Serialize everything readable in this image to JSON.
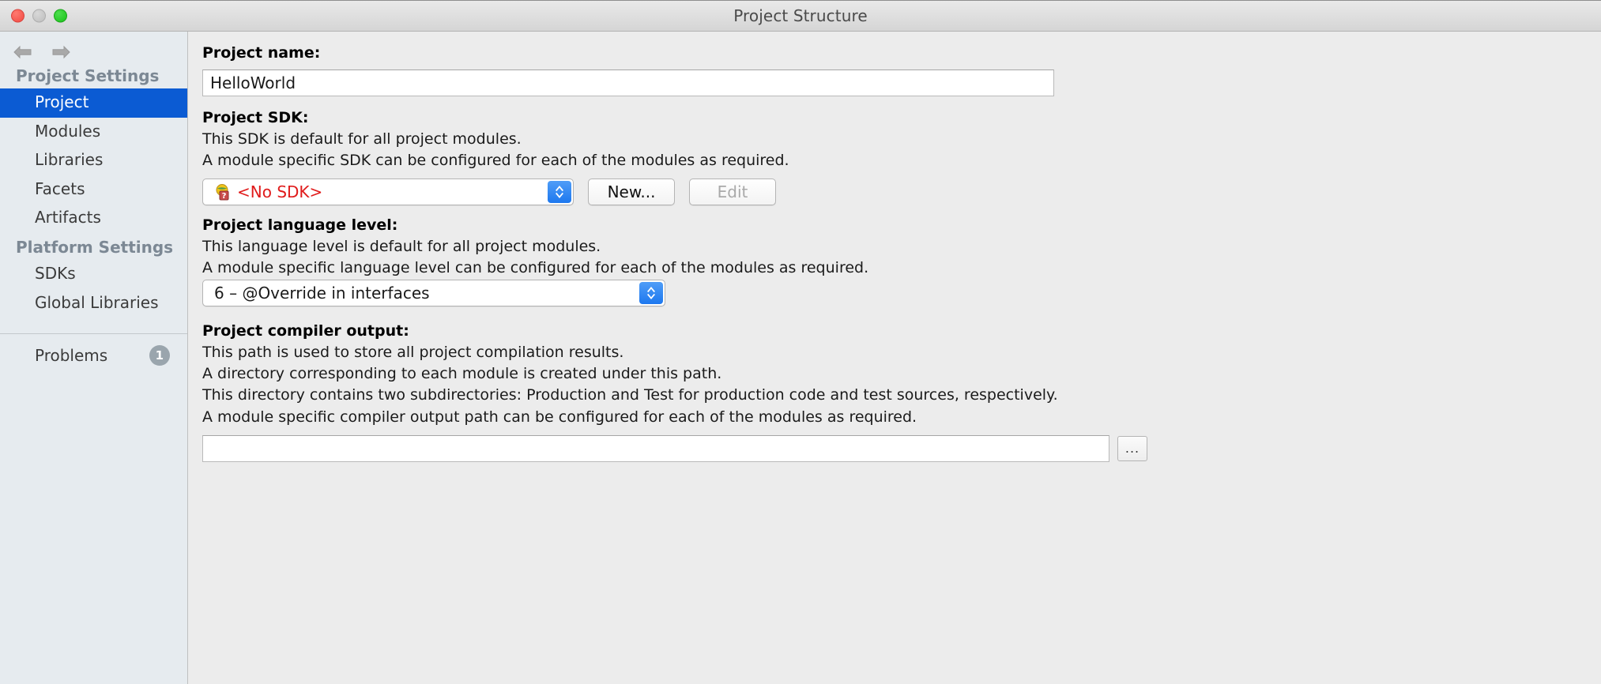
{
  "window": {
    "title": "Project Structure",
    "traffic_lights": [
      "close",
      "minimize",
      "zoom"
    ]
  },
  "sidebar": {
    "nav": {
      "back_icon": "arrow-left-icon",
      "forward_icon": "arrow-right-icon"
    },
    "sections": [
      {
        "header": "Project Settings",
        "items": [
          {
            "label": "Project",
            "selected": true
          },
          {
            "label": "Modules",
            "selected": false
          },
          {
            "label": "Libraries",
            "selected": false
          },
          {
            "label": "Facets",
            "selected": false
          },
          {
            "label": "Artifacts",
            "selected": false
          }
        ]
      },
      {
        "header": "Platform Settings",
        "items": [
          {
            "label": "SDKs",
            "selected": false
          },
          {
            "label": "Global Libraries",
            "selected": false
          }
        ]
      }
    ],
    "problems": {
      "label": "Problems",
      "count": "1"
    }
  },
  "main": {
    "project_name": {
      "label": "Project name:",
      "value": "HelloWorld",
      "placeholder": ""
    },
    "project_sdk": {
      "label": "Project SDK:",
      "description": [
        "This SDK is default for all project modules.",
        "A module specific SDK can be configured for each of the modules as required."
      ],
      "combo_value": "<No SDK>",
      "combo_icon": "unknown-sdk-icon",
      "stepper_icon": "up-down-stepper-icon",
      "new_button": "New...",
      "edit_button": "Edit",
      "edit_disabled": true
    },
    "project_language_level": {
      "label": "Project language level:",
      "description": [
        "This language level is default for all project modules.",
        "A module specific language level can be configured for each of the modules as required."
      ],
      "combo_value": "6 – @Override in interfaces",
      "stepper_icon": "up-down-stepper-icon"
    },
    "project_compiler_output": {
      "label": "Project compiler output:",
      "description": [
        "This path is used to store all project compilation results.",
        "A directory corresponding to each module is created under this path.",
        "This directory contains two subdirectories: Production and Test for production code and test sources, respectively.",
        "A module specific compiler output path can be configured for each of the modules as required."
      ],
      "value": "",
      "placeholder": "",
      "browse_button": "..."
    }
  },
  "colors": {
    "selection_blue": "#0b5bd3",
    "error_red": "#e01b1b",
    "stepper_blue": "#1d78ef",
    "sidebar_bg": "#e6ebef",
    "panel_bg": "#ececec",
    "badge_gray": "#9aa5ad"
  }
}
